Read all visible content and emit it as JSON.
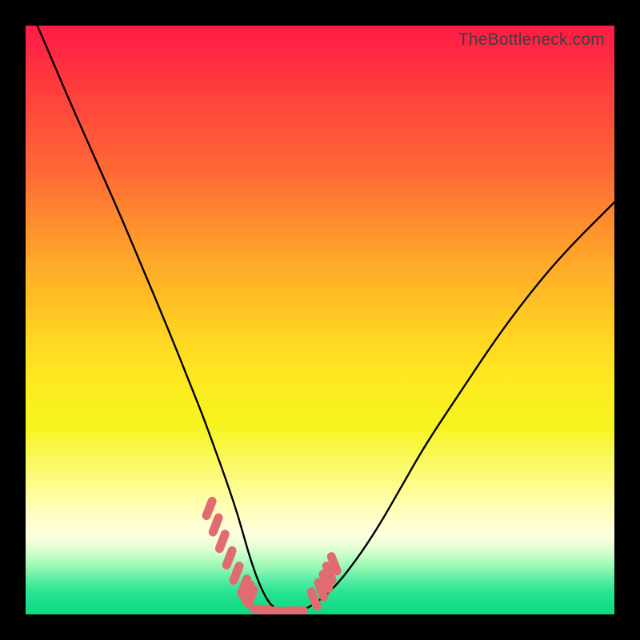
{
  "watermark": "TheBottleneck.com",
  "chart_data": {
    "type": "line",
    "title": "",
    "xlabel": "",
    "ylabel": "",
    "xlim": [
      0,
      100
    ],
    "ylim": [
      0,
      100
    ],
    "series": [
      {
        "name": "bottleneck-curve",
        "x": [
          2,
          5,
          8,
          12,
          16,
          20,
          24,
          28,
          30,
          32,
          34,
          36,
          37,
          38,
          39,
          40,
          41,
          42,
          43,
          44,
          46,
          48,
          52,
          56,
          60,
          64,
          68,
          74,
          80,
          86,
          92,
          100
        ],
        "y": [
          100,
          93,
          86,
          77,
          68,
          58.5,
          49,
          39,
          34,
          28.5,
          23,
          17,
          13.5,
          10,
          7,
          4.5,
          2.5,
          1.3,
          0.8,
          0.6,
          0.6,
          1.0,
          4,
          9,
          15,
          22,
          29,
          38,
          47,
          55,
          62,
          70
        ]
      },
      {
        "name": "threshold-markers-left",
        "x": [
          31.2,
          32.3,
          33.4,
          34.6,
          35.8,
          37.1,
          37.7,
          38.3
        ],
        "y": [
          18.0,
          15.2,
          12.4,
          9.6,
          7.0,
          4.8,
          3.8,
          3.0
        ]
      },
      {
        "name": "threshold-markers-right",
        "x": [
          49.0,
          50.2,
          51.0,
          51.6,
          52.4
        ],
        "y": [
          2.6,
          4.2,
          5.6,
          7.0,
          8.6
        ]
      },
      {
        "name": "threshold-markers-bottom",
        "x": [
          40.0,
          41.5,
          43.0,
          44.5,
          46.0
        ],
        "y": [
          0.9,
          0.6,
          0.5,
          0.5,
          0.6
        ]
      }
    ],
    "marker_color": "#e06c72",
    "curve_color": "#000000"
  }
}
